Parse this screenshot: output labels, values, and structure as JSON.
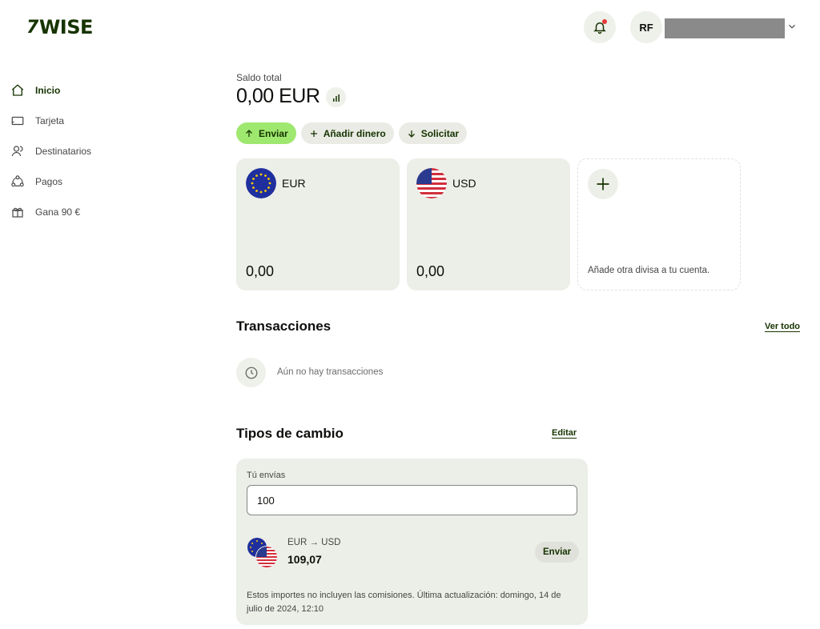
{
  "brand": {
    "logo_text": "WISE",
    "logo_mark": "7"
  },
  "header": {
    "avatar_initials": "RF"
  },
  "sidebar": {
    "items": [
      {
        "label": "Inicio",
        "icon": "home-icon",
        "active": true
      },
      {
        "label": "Tarjeta",
        "icon": "card-icon",
        "active": false
      },
      {
        "label": "Destinatarios",
        "icon": "recipients-icon",
        "active": false
      },
      {
        "label": "Pagos",
        "icon": "payments-icon",
        "active": false
      },
      {
        "label": "Gana 90 €",
        "icon": "gift-icon",
        "active": false
      }
    ]
  },
  "balance": {
    "label": "Saldo total",
    "value": "0,00 EUR"
  },
  "actions": [
    {
      "label": "Enviar",
      "icon": "arrow-up-icon"
    },
    {
      "label": "Añadir dinero",
      "icon": "plus-icon"
    },
    {
      "label": "Solicitar",
      "icon": "arrow-down-icon"
    }
  ],
  "accounts": [
    {
      "currency": "EUR",
      "amount": "0,00",
      "flag": "eu-flag-icon"
    },
    {
      "currency": "USD",
      "amount": "0,00",
      "flag": "us-flag-icon"
    }
  ],
  "add_currency": {
    "hint": "Añade otra divisa a tu cuenta."
  },
  "transactions": {
    "title": "Transacciones",
    "see_all": "Ver todo",
    "empty": "Aún no hay transacciones"
  },
  "rates": {
    "title": "Tipos de cambio",
    "edit": "Editar",
    "send_label": "Tú envías",
    "send_value": "100",
    "pair": "EUR → USD",
    "rate": "109,07",
    "send_button": "Enviar",
    "note": "Estos importes no incluyen las comisiones. Última actualización: domingo, 14 de julio de 2024, 12:10"
  },
  "colors": {
    "brand": "#163300",
    "accent": "#9fe870",
    "card": "#eceee8"
  }
}
